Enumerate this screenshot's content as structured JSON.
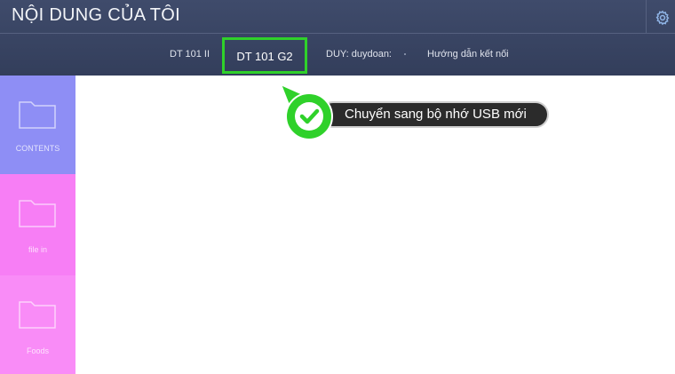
{
  "header": {
    "title": "NỘI DUNG CỦA TÔI",
    "settings_icon": "gear-icon"
  },
  "tabs": [
    {
      "label": "DT 101 II",
      "selected": false
    },
    {
      "label": "DT 101 G2",
      "selected": true
    },
    {
      "label": "DUY: duydoan:",
      "selected": false
    },
    {
      "label": "Hướng dẫn kết nối",
      "selected": false
    }
  ],
  "sidebar": {
    "tiles": [
      {
        "label": "CONTENTS",
        "icon": "folder-icon",
        "color": "#8e8ef5"
      },
      {
        "label": "file in",
        "icon": "folder-icon",
        "color": "#f77ef5"
      },
      {
        "label": "Foods",
        "icon": "folder-icon",
        "color": "#f98cf7"
      }
    ]
  },
  "callout": {
    "text": "Chuyển sang bộ nhớ USB mới",
    "icon": "checkmark-icon",
    "accent": "#2fd12a"
  }
}
